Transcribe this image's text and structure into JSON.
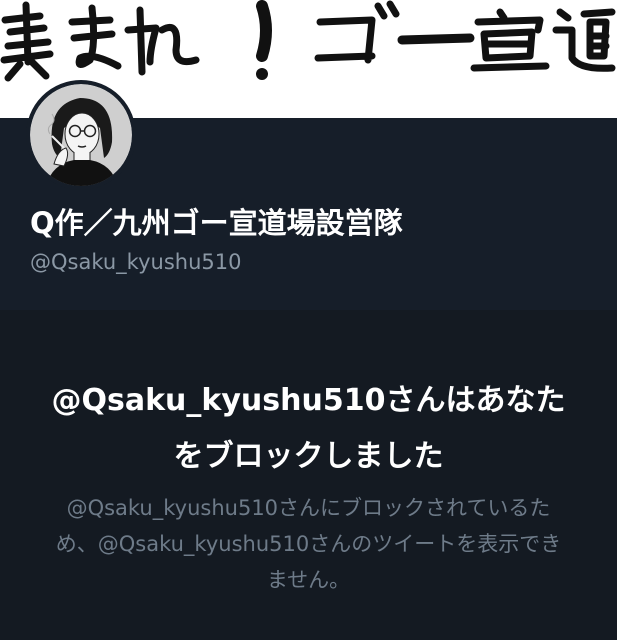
{
  "banner": {
    "text": "集まれ！ゴー宣道場"
  },
  "profile": {
    "display_name": "Q作／九州ゴー宣道場設営隊",
    "handle": "@Qsaku_kyushu510"
  },
  "blocked": {
    "title": "@Qsaku_kyushu510さんはあなたをブロックしました",
    "description": "@Qsaku_kyushu510さんにブロックされているため、@Qsaku_kyushu510さんのツイートを表示できません。"
  }
}
